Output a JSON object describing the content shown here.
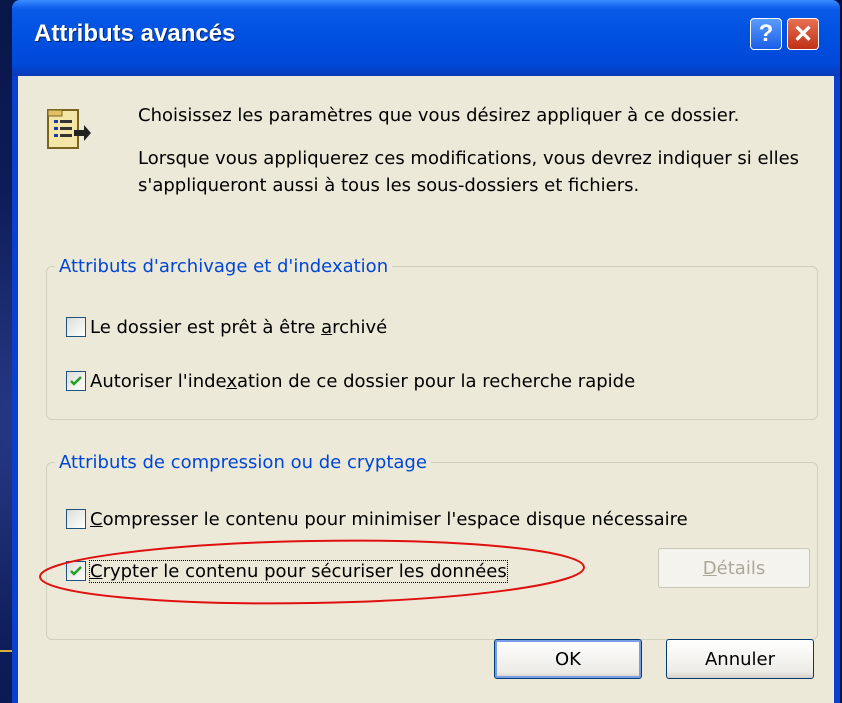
{
  "dialog": {
    "title": "Attributs avancés",
    "help_glyph": "?",
    "close_glyph": "✕"
  },
  "intro": {
    "line1": "Choisissez les paramètres que vous désirez appliquer à ce dossier.",
    "line2": "Lorsque vous appliquerez ces modifications, vous devrez indiquer si elles s'appliqueront aussi à tous les sous-dossiers et fichiers."
  },
  "archive_group": {
    "legend": "Attributs d'archivage et d'indexation",
    "archive_checkbox": {
      "pre": "Le dossier est prêt à être ",
      "mnemonic": "a",
      "post": "rchivé",
      "checked": false
    },
    "index_checkbox": {
      "pre": "Autoriser l'inde",
      "mnemonic": "x",
      "post": "ation de ce dossier pour la recherche rapide",
      "checked": true
    }
  },
  "compress_group": {
    "legend": "Attributs de compression ou de cryptage",
    "compress_checkbox": {
      "pre": "",
      "mnemonic": "C",
      "post": "ompresser le contenu pour minimiser l'espace disque nécessaire",
      "checked": false
    },
    "encrypt_checkbox": {
      "pre": "",
      "mnemonic": "C",
      "post": "rypter le contenu pour sécuriser les données",
      "checked": true
    },
    "details_button": {
      "mnemonic": "D",
      "post": "étails"
    }
  },
  "buttons": {
    "ok": "OK",
    "cancel": "Annuler"
  },
  "colors": {
    "title_bar": "#0050e0",
    "dialog_bg": "#ece9d8",
    "legend_text": "#0046d5",
    "checkmark": "#21a121",
    "annotation": "#e01010"
  }
}
